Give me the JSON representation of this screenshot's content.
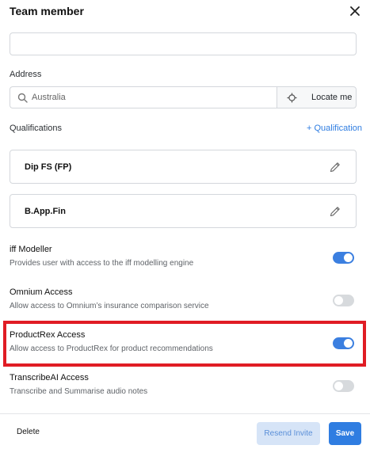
{
  "dialog": {
    "title": "Team member"
  },
  "address": {
    "label": "Address",
    "value": "Australia",
    "locate_label": "Locate me"
  },
  "qualifications": {
    "label": "Qualifications",
    "add_label": "+ Qualification",
    "items": [
      {
        "name": "Dip FS (FP)"
      },
      {
        "name": "B.App.Fin"
      }
    ]
  },
  "permissions": [
    {
      "title": "iff Modeller",
      "description": "Provides user with access to the iff modelling engine",
      "enabled": true
    },
    {
      "title": "Omnium Access",
      "description": "Allow access to Omnium’s insurance comparison service",
      "enabled": false
    },
    {
      "title": "ProductRex Access",
      "description": "Allow access to ProductRex for product recommendations",
      "enabled": true
    },
    {
      "title": "TranscribeAI Access",
      "description": "Transcribe and Summarise audio notes",
      "enabled": false
    }
  ],
  "footer": {
    "delete_label": "Delete",
    "resend_label": "Resend Invite",
    "save_label": "Save"
  },
  "colors": {
    "accent": "#2f7de1",
    "toggle_on": "#3b7fe0",
    "toggle_off": "#d7dadd",
    "highlight": "#e01c24"
  },
  "icons": {
    "close": "close-icon",
    "search": "search-icon",
    "locate": "crosshair-icon",
    "edit": "pencil-icon"
  }
}
